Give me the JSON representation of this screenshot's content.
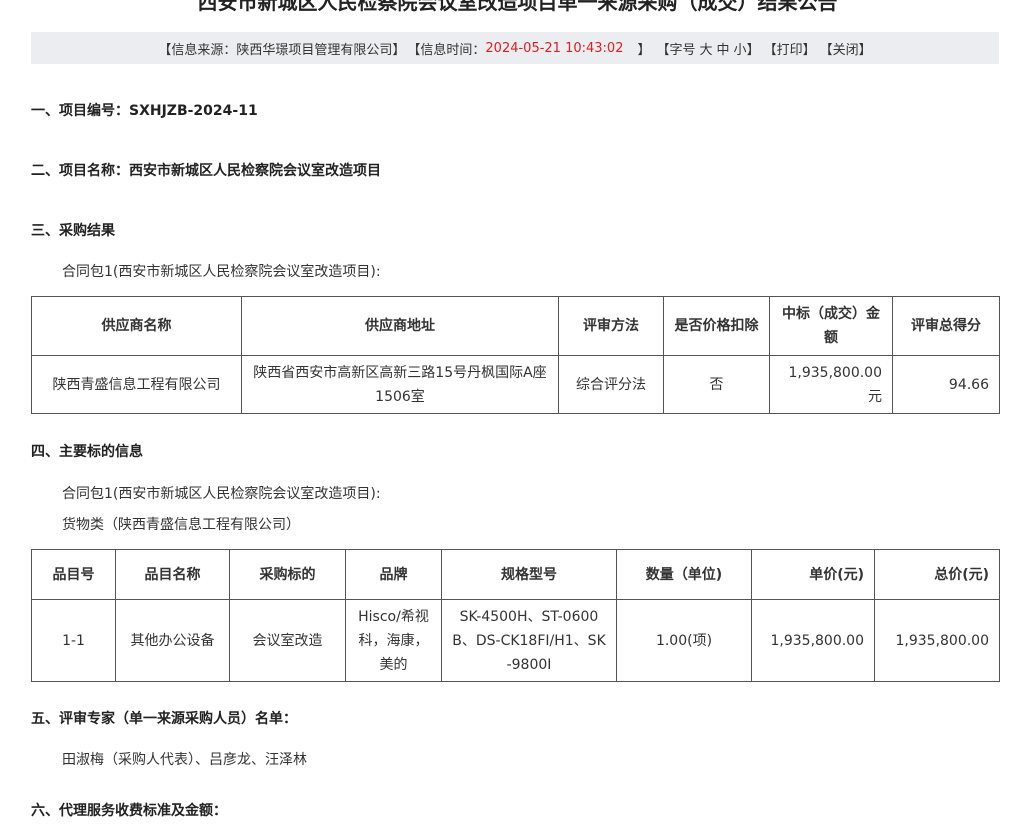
{
  "title": "西安市新城区人民检察院会议室改造项目单一来源采购（成交）结果公告",
  "info": {
    "source": "【信息来源：陕西华璟项目管理有限公司】",
    "time_prefix": "【信息时间：",
    "time": "2024-05-21 10:43:02",
    "time_suffix": "】",
    "font_prefix": "【字号",
    "font_large": "大",
    "font_mid": "中",
    "font_small": "小",
    "font_suffix": "】",
    "print": "【打印】",
    "close": "【关闭】"
  },
  "sections": {
    "s1": "一、项目编号：SXHJZB-2024-11",
    "s2": "二、项目名称：西安市新城区人民检察院会议室改造项目",
    "s3": "三、采购结果",
    "s4": "四、主要标的信息",
    "s5": "五、评审专家（单一来源采购人员）名单：",
    "s6": "六、代理服务收费标准及金额："
  },
  "result": {
    "package": "合同包1(西安市新城区人民检察院会议室改造项目):",
    "headers": [
      "供应商名称",
      "供应商地址",
      "评审方法",
      "是否价格扣除",
      "中标（成交）金额",
      "评审总得分"
    ],
    "row": [
      "陕西青盛信息工程有限公司",
      "陕西省西安市高新区高新三路15号丹枫国际A座1506室",
      "综合评分法",
      "否",
      "1,935,800.00元",
      "94.66"
    ]
  },
  "subject": {
    "package": "合同包1(西安市新城区人民检察院会议室改造项目):",
    "category": "货物类（陕西青盛信息工程有限公司）",
    "headers": [
      "品目号",
      "品目名称",
      "采购标的",
      "品牌",
      "规格型号",
      "数量（单位)",
      "单价(元)",
      "总价(元)"
    ],
    "row": [
      "1-1",
      "其他办公设备",
      "会议室改造",
      "Hisco/希视科，海康，美的",
      "SK-4500H、ST-0600B、DS-CK18FI/H1、SK-9800I",
      "1.00(项)",
      "1,935,800.00",
      "1,935,800.00"
    ]
  },
  "experts": "田淑梅（采购人代表）、吕彦龙、汪泽林"
}
